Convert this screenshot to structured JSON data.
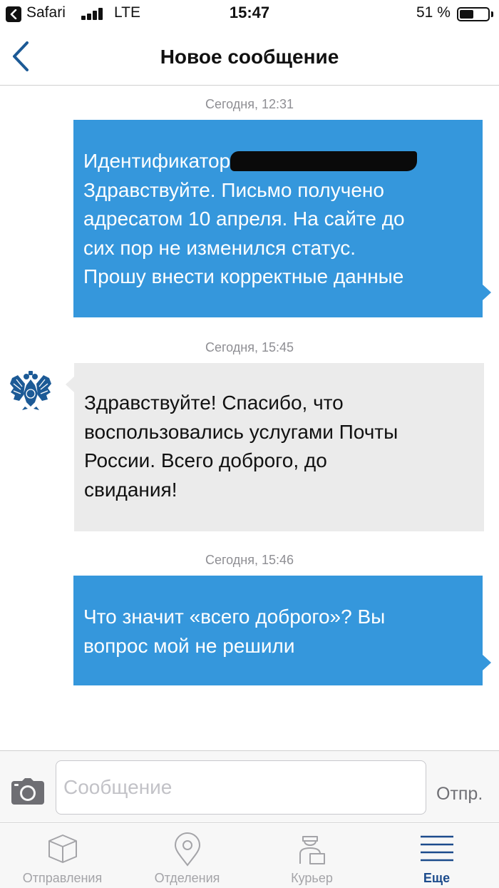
{
  "status_bar": {
    "back_app": "Safari",
    "network": "LTE",
    "time": "15:47",
    "battery_text": "51 %",
    "battery_level": 0.51
  },
  "nav": {
    "title": "Новое сообщение",
    "back_icon": "chevron-left-icon"
  },
  "messages": [
    {
      "timestamp": "Сегодня, 12:31",
      "direction": "outgoing",
      "lines_before_redaction": "Идентификатор",
      "redacted": true,
      "lines": [
        "Здравствуйте. Письмо получено",
        "адресатом 10 апреля. На сайте до",
        "сих пор не изменился статус.",
        "Прошу внести корректные данные"
      ]
    },
    {
      "timestamp": "Сегодня, 15:45",
      "direction": "incoming",
      "lines": [
        "Здравствуйте! Спасибо, что",
        "воспользовались услугами Почты",
        "России. Всего доброго, до",
        "свидания!"
      ]
    },
    {
      "timestamp": "Сегодня, 15:46",
      "direction": "outgoing",
      "lines": [
        "Что значит «всего доброго»? Вы",
        "вопрос мой не решили"
      ]
    }
  ],
  "composer": {
    "placeholder": "Сообщение",
    "value": "",
    "send_label": "Отпр.",
    "camera_icon": "camera-icon"
  },
  "tabs": [
    {
      "label": "Отправления",
      "icon": "parcel-box-icon",
      "active": false
    },
    {
      "label": "Отделения",
      "icon": "location-pin-icon",
      "active": false
    },
    {
      "label": "Курьер",
      "icon": "courier-icon",
      "active": false
    },
    {
      "label": "Еще",
      "icon": "menu-lines-icon",
      "active": true
    }
  ],
  "colors": {
    "outgoing_bubble": "#3597dc",
    "incoming_bubble": "#ebebeb",
    "active_tab": "#1c4b8c",
    "inactive_tab": "#a4a4a8"
  }
}
